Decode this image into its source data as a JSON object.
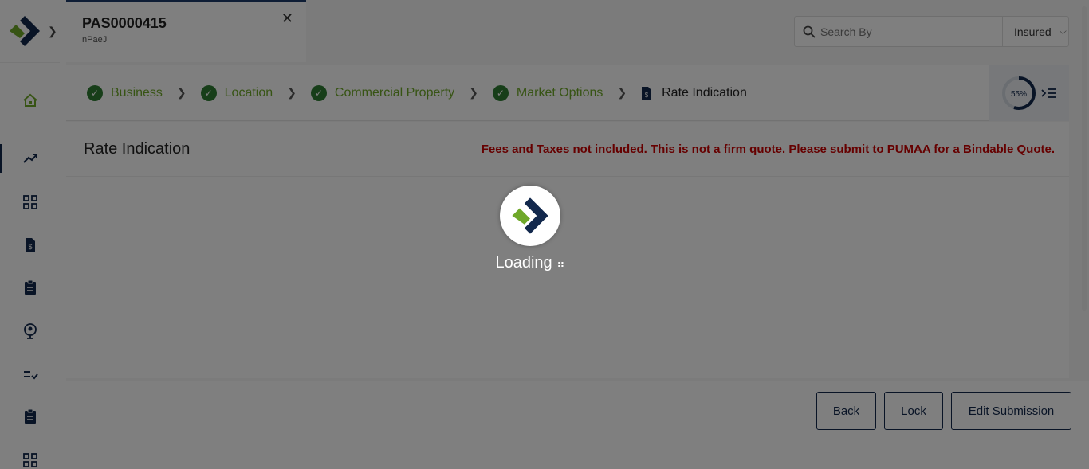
{
  "tab": {
    "title": "PAS0000415",
    "subtitle": "nPaeJ"
  },
  "search": {
    "placeholder": "Search By",
    "filter_value": "Insured"
  },
  "steps": [
    {
      "label": "Business",
      "status": "done"
    },
    {
      "label": "Location",
      "status": "done"
    },
    {
      "label": "Commercial Property",
      "status": "done"
    },
    {
      "label": "Market Options",
      "status": "done"
    },
    {
      "label": "Rate Indication",
      "status": "current"
    }
  ],
  "progress": {
    "percent_label": "55%",
    "value": 0.55
  },
  "content": {
    "title": "Rate Indication",
    "warning": "Fees and Taxes not included. This is not a firm quote. Please submit to PUMAA for a Bindable Quote."
  },
  "buttons": {
    "back": "Back",
    "lock": "Lock",
    "edit_submission": "Edit Submission"
  },
  "loading": {
    "text": "Loading"
  },
  "colors": {
    "brand_navy": "#12284c",
    "brand_green": "#6fa829",
    "warning_red": "#cc0000",
    "check_green": "#2e7d32"
  },
  "rail_icons": [
    "home-icon",
    "trending-up-icon",
    "dashboard-icon",
    "document-dollar-icon",
    "clipboard-icon",
    "location-pin-icon",
    "checklist-icon",
    "clipboard-icon",
    "grid-icon"
  ]
}
